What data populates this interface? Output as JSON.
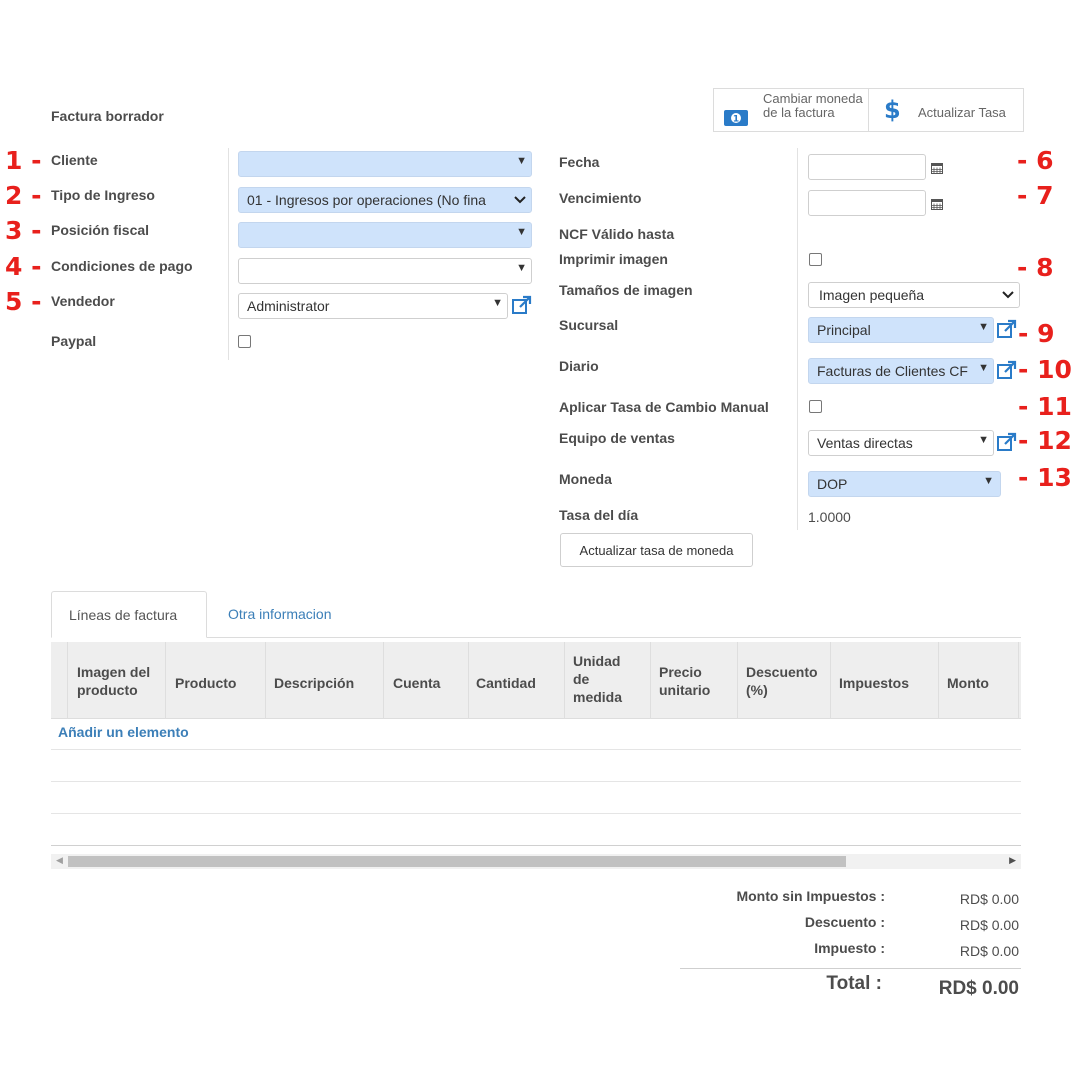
{
  "form": {
    "title": "Factura borrador",
    "buttons": {
      "change_currency": "Cambiar moneda de la factura",
      "update_rate": "Actualizar Tasa",
      "update_currency_rate": "Actualizar tasa de moneda"
    },
    "left": {
      "cliente": {
        "label": "Cliente",
        "value": ""
      },
      "tipo_ingreso": {
        "label": "Tipo de Ingreso",
        "value": "01 - Ingresos por operaciones (No fina"
      },
      "posicion_fiscal": {
        "label": "Posición fiscal",
        "value": ""
      },
      "condiciones_pago": {
        "label": "Condiciones de pago",
        "value": ""
      },
      "vendedor": {
        "label": "Vendedor",
        "value": "Administrator"
      },
      "paypal": {
        "label": "Paypal"
      }
    },
    "right": {
      "fecha": {
        "label": "Fecha",
        "value": ""
      },
      "vencimiento": {
        "label": "Vencimiento",
        "value": ""
      },
      "ncf_valido": {
        "label": "NCF Válido hasta"
      },
      "imprimir_imagen": {
        "label": "Imprimir imagen"
      },
      "tamanos_imagen": {
        "label": "Tamaños de imagen",
        "value": "Imagen pequeña"
      },
      "sucursal": {
        "label": "Sucursal",
        "value": "Principal"
      },
      "diario": {
        "label": "Diario",
        "value": "Facturas de Clientes CF"
      },
      "tasa_manual": {
        "label": "Aplicar Tasa de Cambio Manual"
      },
      "equipo_ventas": {
        "label": "Equipo de ventas",
        "value": "Ventas directas"
      },
      "moneda": {
        "label": "Moneda",
        "value": "DOP"
      },
      "tasa_dia": {
        "label": "Tasa del día",
        "value": "1.0000"
      }
    }
  },
  "annotations": {
    "n1": "1 -",
    "n2": "2 -",
    "n3": "3 -",
    "n4": "4 -",
    "n5": "5 -",
    "n6": "- 6",
    "n7": "- 7",
    "n8": "- 8",
    "n9": "- 9",
    "n10": "- 10",
    "n11": "- 11",
    "n12": "- 12",
    "n13": "- 13",
    "color": "#e8201c"
  },
  "tabs": [
    {
      "label": "Líneas de factura",
      "active": true
    },
    {
      "label": "Otra informacion",
      "active": false
    }
  ],
  "table": {
    "columns": [
      "Imagen del producto",
      "Producto",
      "Descripción",
      "Cuenta",
      "Cantidad",
      "Unidad de medida",
      "Precio unitario",
      "Descuento (%)",
      "Impuestos",
      "Monto"
    ],
    "add_item": "Añadir un elemento"
  },
  "totals": {
    "subtotal_label": "Monto sin Impuestos :",
    "subtotal_value": "RD$ 0.00",
    "discount_label": "Descuento :",
    "discount_value": "RD$ 0.00",
    "tax_label": "Impuesto :",
    "tax_value": "RD$ 0.00",
    "total_label": "Total :",
    "total_value": "RD$ 0.00"
  },
  "colors": {
    "required_field": "#cfe3fb",
    "link": "#3c7fb8",
    "icon_blue": "#2a7bc8"
  },
  "icons": [
    "calendar-icon",
    "external-link-icon",
    "money-icon",
    "dollar-icon",
    "dropdown-caret-icon"
  ]
}
